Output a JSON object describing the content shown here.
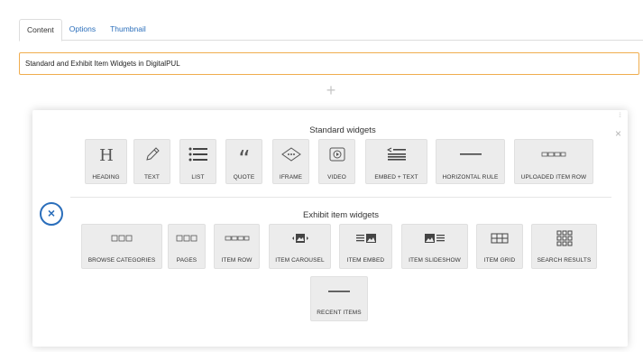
{
  "tabs": [
    {
      "label": "Content",
      "active": true
    },
    {
      "label": "Options",
      "active": false
    },
    {
      "label": "Thumbnail",
      "active": false
    }
  ],
  "title_input": {
    "value": "Standard and Exhibit Item Widgets in DigitalPUL"
  },
  "add_block": {
    "icon": "plus-icon",
    "symbol": "+"
  },
  "panel": {
    "close_symbol": "×",
    "cancel_symbol": "×",
    "standard": {
      "title": "Standard widgets",
      "items": [
        {
          "label": "HEADING",
          "icon": "heading-icon"
        },
        {
          "label": "TEXT",
          "icon": "pencil-icon"
        },
        {
          "label": "LIST",
          "icon": "list-icon"
        },
        {
          "label": "QUOTE",
          "icon": "quote-icon"
        },
        {
          "label": "IFRAME",
          "icon": "iframe-icon"
        },
        {
          "label": "VIDEO",
          "icon": "video-icon"
        },
        {
          "label": "EMBED + TEXT",
          "icon": "embed-text-icon"
        },
        {
          "label": "HORIZONTAL RULE",
          "icon": "horizontal-rule-icon"
        },
        {
          "label": "UPLOADED ITEM ROW",
          "icon": "uploaded-item-row-icon"
        }
      ]
    },
    "exhibit": {
      "title": "Exhibit item widgets",
      "items": [
        {
          "label": "BROWSE CATEGORIES",
          "icon": "browse-categories-icon"
        },
        {
          "label": "PAGES",
          "icon": "pages-icon"
        },
        {
          "label": "ITEM ROW",
          "icon": "item-row-icon"
        },
        {
          "label": "ITEM CAROUSEL",
          "icon": "item-carousel-icon"
        },
        {
          "label": "ITEM EMBED",
          "icon": "item-embed-icon"
        },
        {
          "label": "ITEM SLIDESHOW",
          "icon": "item-slideshow-icon"
        },
        {
          "label": "ITEM GRID",
          "icon": "item-grid-icon"
        },
        {
          "label": "SEARCH RESULTS",
          "icon": "search-results-icon"
        },
        {
          "label": "RECENT ITEMS",
          "icon": "recent-items-icon"
        }
      ]
    }
  }
}
